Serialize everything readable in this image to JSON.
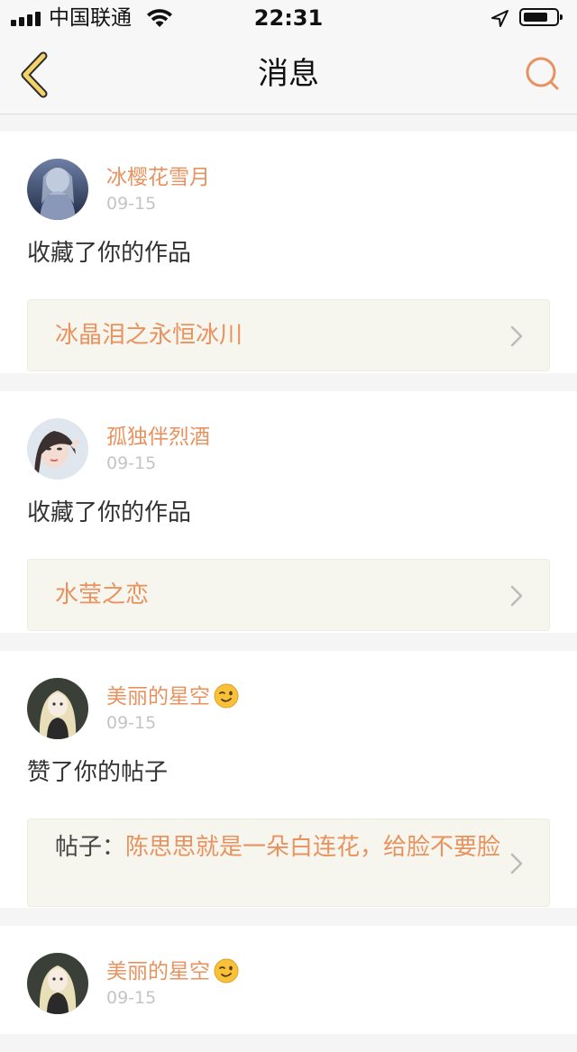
{
  "status_bar": {
    "carrier": "中国联通",
    "time": "22:31",
    "signal_bars": 4,
    "battery_level": 0.6
  },
  "nav": {
    "title": "消息",
    "back_icon": "chevron-left-icon",
    "search_icon": "search-icon",
    "accent_color": "#e8935f",
    "back_color": "#f1d36a"
  },
  "messages": [
    {
      "user": "冰樱花雪月",
      "date": "09-15",
      "action": "收藏了你的作品",
      "link_prefix": "",
      "link_text": "冰晶泪之永恒冰川",
      "emoji": ""
    },
    {
      "user": "孤独伴烈酒",
      "date": "09-15",
      "action": "收藏了你的作品",
      "link_prefix": "",
      "link_text": "水莹之恋",
      "emoji": ""
    },
    {
      "user": "美丽的星空",
      "date": "09-15",
      "action": "赞了你的帖子",
      "link_prefix": "帖子：",
      "link_text": "陈思思就是一朵白连花，给脸不要脸",
      "emoji": "wink-emoji"
    },
    {
      "user": "美丽的星空",
      "date": "09-15",
      "action": "",
      "link_prefix": "",
      "link_text": "",
      "emoji": "wink-emoji"
    }
  ]
}
